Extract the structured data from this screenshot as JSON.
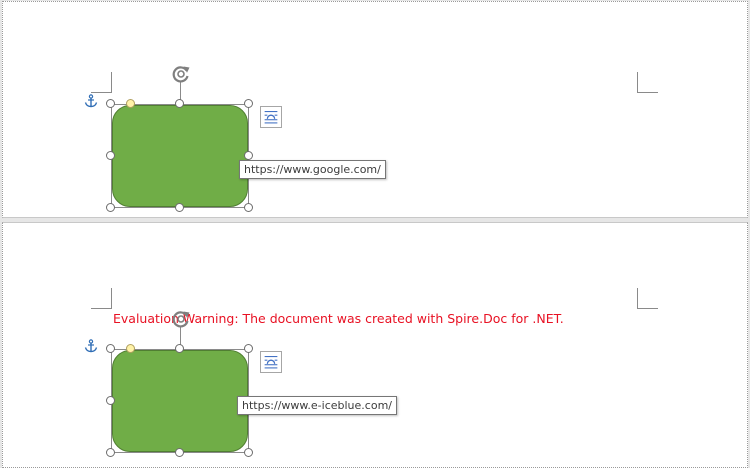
{
  "document": {
    "evaluation_warning": "Evaluation Warning: The document was created with Spire.Doc for .NET."
  },
  "pages": [
    {
      "shape": {
        "fill_color": "#70ad47",
        "hyperlink_tooltip": "https://www.google.com/"
      },
      "icons": [
        "anchor-icon",
        "rotate-icon",
        "layout-options-icon"
      ]
    },
    {
      "shape": {
        "fill_color": "#70ad47",
        "hyperlink_tooltip": "https://www.e-iceblue.com/"
      },
      "icons": [
        "anchor-icon",
        "rotate-icon",
        "layout-options-icon"
      ]
    }
  ],
  "colors": {
    "warning_text": "#e81123",
    "shape_fill": "#70ad47",
    "anchor": "#2f6db5"
  }
}
